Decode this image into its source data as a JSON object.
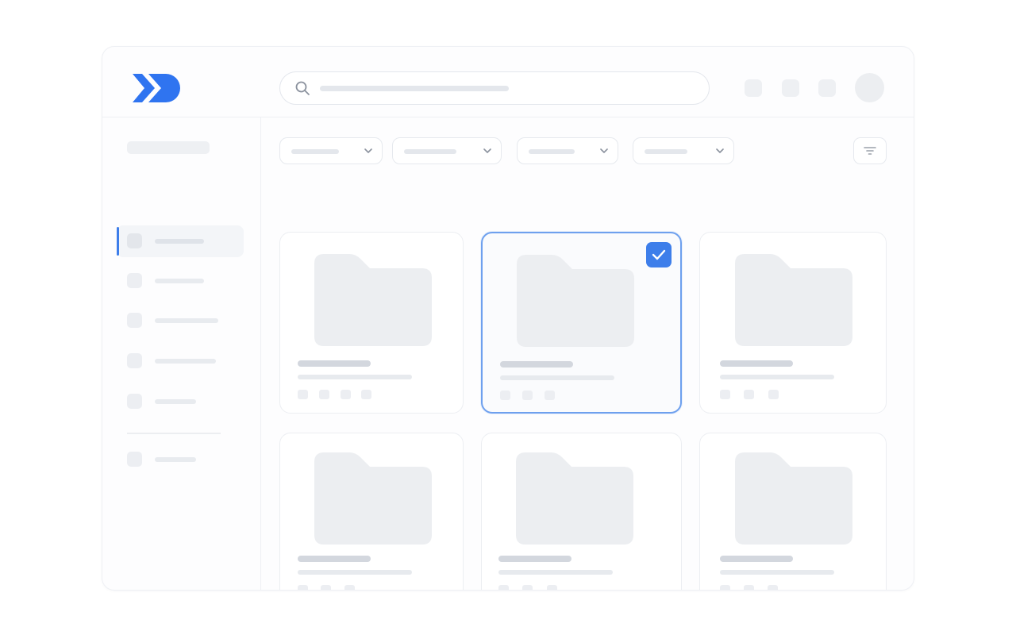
{
  "header": {
    "logo_icon": "double-chevron-logo-icon",
    "brand_color": "#2f74f0",
    "search": {
      "value": "",
      "placeholder": ""
    },
    "toolbar_buttons": [
      "toolbar-button",
      "toolbar-button",
      "toolbar-button"
    ],
    "avatar_icon": "avatar"
  },
  "sidebar": {
    "active_index": 0,
    "items_main": [
      "item",
      "item",
      "item",
      "item",
      "item"
    ],
    "items_secondary": [
      "item"
    ]
  },
  "filters": {
    "count": 4,
    "icon": "chevron-down-icon",
    "sort_icon": "filter-lines-icon"
  },
  "grid": {
    "card_icon": "folder-icon",
    "selected_index": 1,
    "selection_color": "#3d7eea",
    "cards": [
      {
        "selected": false,
        "meta_count": 4
      },
      {
        "selected": true,
        "meta_count": 3
      },
      {
        "selected": false,
        "meta_count": 3
      },
      {
        "selected": false,
        "meta_count": 3
      },
      {
        "selected": false,
        "meta_count": 3
      },
      {
        "selected": false,
        "meta_count": 3
      }
    ]
  }
}
